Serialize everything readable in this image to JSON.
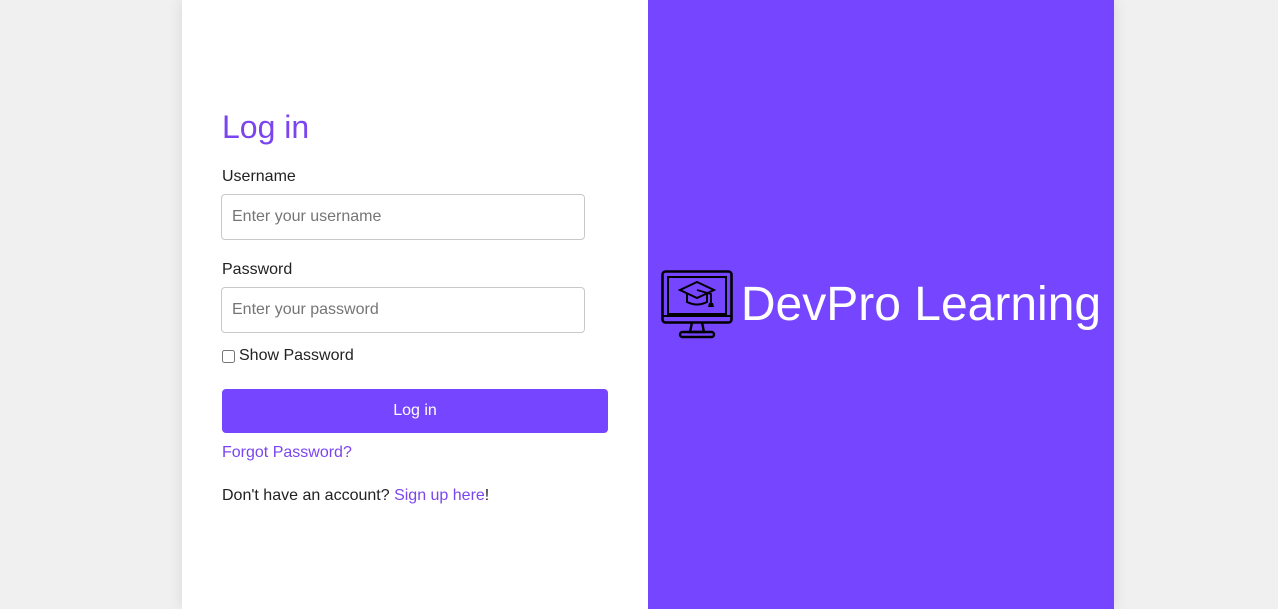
{
  "login": {
    "title": "Log in",
    "username_label": "Username",
    "username_placeholder": "Enter your username",
    "username_value": "",
    "password_label": "Password",
    "password_placeholder": "Enter your password",
    "password_value": "",
    "show_password_label": "Show Password",
    "show_password_checked": false,
    "submit_label": "Log in",
    "forgot_password": "Forgot Password?",
    "signup_prompt": "Don't have an account? ",
    "signup_link": "Sign up here",
    "signup_suffix": "!"
  },
  "brand": {
    "name": "DevPro Learning",
    "icon": "monitor-graduation-cap-icon"
  },
  "colors": {
    "accent": "#7645ff",
    "link": "#7a45ee",
    "page_background": "#f0f0f0",
    "card_background": "#ffffff"
  }
}
